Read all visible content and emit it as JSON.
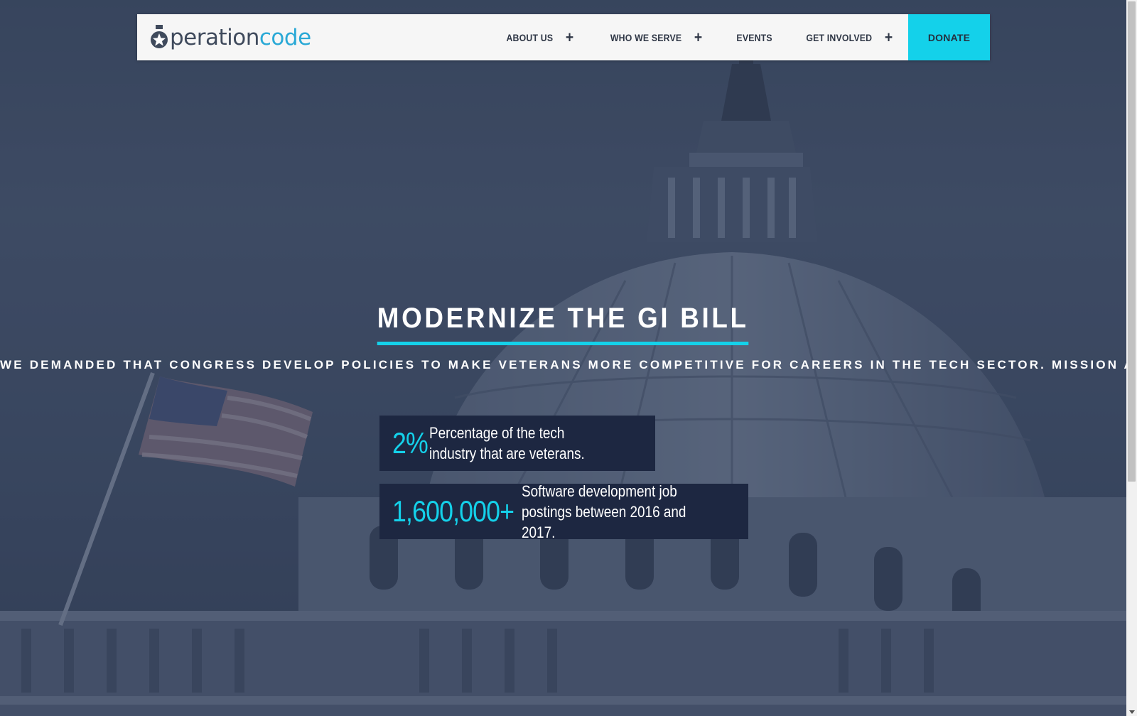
{
  "brand": {
    "logo_dark": "peration",
    "logo_cyan": "code",
    "accent_color": "#14d1ea"
  },
  "nav": {
    "items": [
      {
        "label": "ABOUT US",
        "has_submenu": true,
        "icon": "plus-icon"
      },
      {
        "label": "WHO WE SERVE",
        "has_submenu": true,
        "icon": "plus-icon"
      },
      {
        "label": "EVENTS",
        "has_submenu": false
      },
      {
        "label": "GET INVOLVED",
        "has_submenu": true,
        "icon": "plus-icon"
      }
    ],
    "donate_label": "DONATE"
  },
  "hero": {
    "title": "MODERNIZE THE GI BILL",
    "subtitle": "WE DEMANDED THAT CONGRESS DEVELOP POLICIES TO MAKE VETERANS MORE COMPETITIVE FOR CAREERS IN THE TECH SECTOR. MISSION ACCOMPLISHED!"
  },
  "stats": [
    {
      "value": "2%",
      "description": "Percentage of the tech industry that are veterans."
    },
    {
      "value": "1,600,000+",
      "description": "Software development job postings between 2016 and 2017."
    }
  ]
}
